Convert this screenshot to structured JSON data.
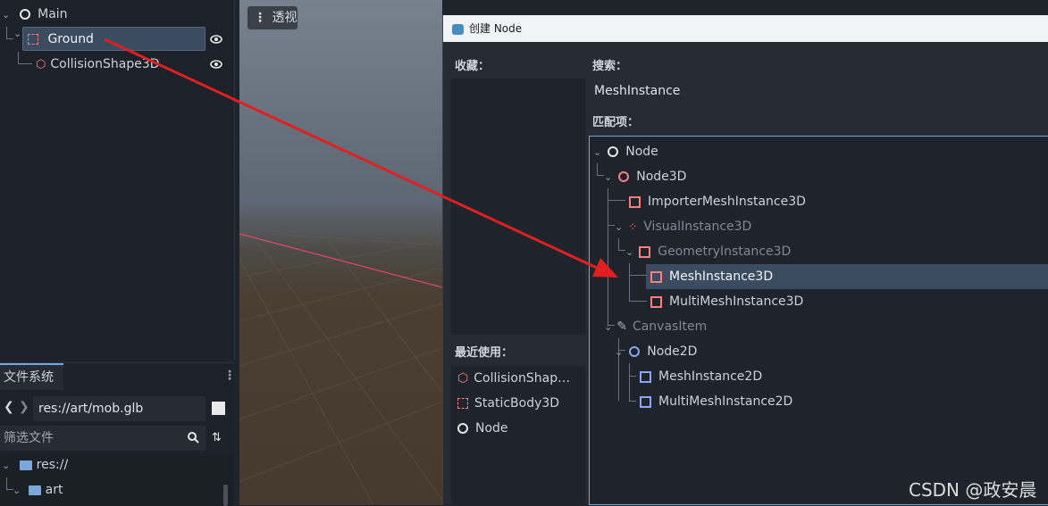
{
  "scene_tree": {
    "root": "Main",
    "ground": "Ground",
    "collision": "CollisionShape3D"
  },
  "filesystem": {
    "tab": "文件系统",
    "path": "res://art/mob.glb",
    "filter_placeholder": "筛选文件",
    "items": [
      "res://",
      "art"
    ]
  },
  "viewport": {
    "view_button": "透视"
  },
  "dialog": {
    "title": "创建 Node",
    "favorites_label": "收藏：",
    "search_label": "搜索：",
    "search_value": "MeshInstance",
    "matches_label": "匹配项：",
    "recent_label": "最近使用：",
    "recent": [
      "CollisionShap…",
      "StaticBody3D",
      "Node"
    ],
    "tree": [
      "Node",
      "Node3D",
      "ImporterMeshInstance3D",
      "VisualInstance3D",
      "GeometryInstance3D",
      "MeshInstance3D",
      "MultiMeshInstance3D",
      "CanvasItem",
      "Node2D",
      "MeshInstance2D",
      "MultiMeshInstance2D"
    ]
  },
  "watermark": "CSDN @政安晨",
  "colors": {
    "accent": "#6fa8dc",
    "arrow": "#e02020",
    "node3d": "#fc7f7f",
    "node2d": "#8da5f3"
  }
}
